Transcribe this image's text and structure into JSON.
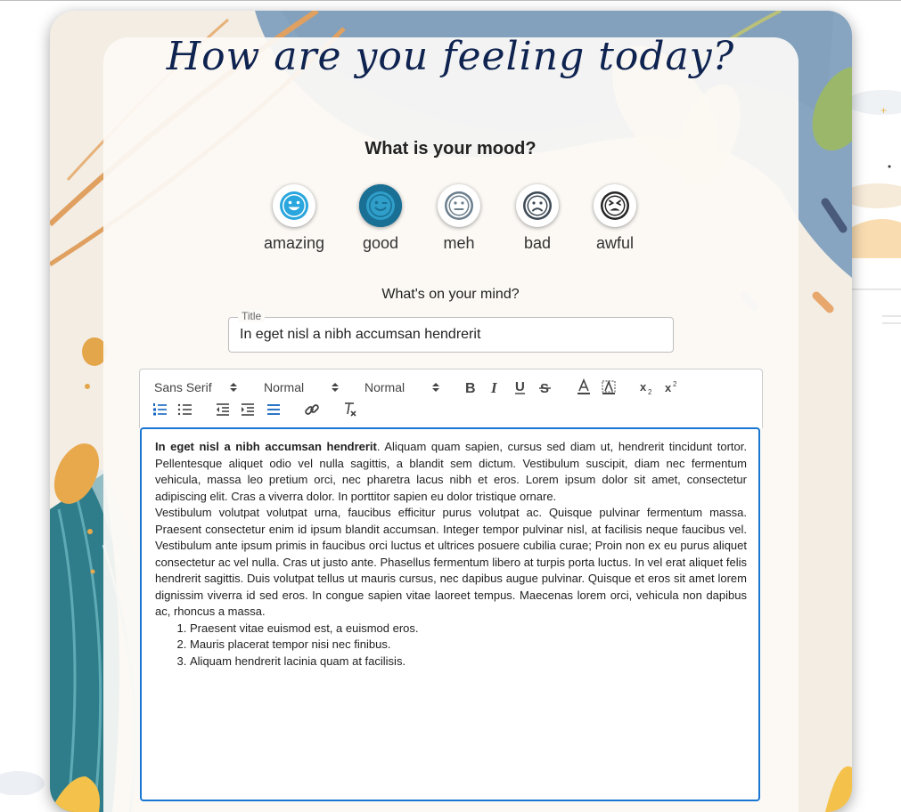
{
  "heading": "How are you feeling today?",
  "mood_question": "What is your mood?",
  "moods": [
    {
      "label": "amazing",
      "icon": "grinning-face-icon",
      "color": "#29a6dd"
    },
    {
      "label": "good",
      "icon": "winking-face-icon",
      "color": "#1a6f94",
      "selected": true
    },
    {
      "label": "meh",
      "icon": "neutral-face-icon",
      "color": "#6b7f8e"
    },
    {
      "label": "bad",
      "icon": "frowning-face-icon",
      "color": "#3d4a55"
    },
    {
      "label": "awful",
      "icon": "tired-face-icon",
      "color": "#262626"
    }
  ],
  "mind_prompt": "What's on your mind?",
  "title_field": {
    "label": "Title",
    "value": "In eget nisl a nibh accumsan hendrerit"
  },
  "toolbar": {
    "font": "Sans Serif",
    "size": "Normal",
    "header": "Normal",
    "icons": [
      "bold-icon",
      "italic-icon",
      "underline-icon",
      "strikethrough-icon",
      "text-color-icon",
      "background-color-icon",
      "subscript-icon",
      "superscript-icon",
      "ordered-list-icon",
      "bullet-list-icon",
      "outdent-icon",
      "indent-icon",
      "justify-icon",
      "link-icon",
      "clear-format-icon"
    ],
    "active_color": "#1565c0"
  },
  "editor": {
    "para1_bold": "In eget nisl a nibh accumsan hendrerit",
    "para1_rest": ". Aliquam quam sapien, cursus sed diam ut, hendrerit tincidunt tortor. Pellentesque aliquet odio vel nulla sagittis, a blandit sem dictum. Vestibulum suscipit, diam nec fermentum vehicula, massa leo pretium orci, nec pharetra lacus nibh et eros. Lorem ipsum dolor sit amet, consectetur adipiscing elit. Cras a viverra dolor. In porttitor sapien eu dolor tristique ornare.",
    "para2": "Vestibulum volutpat volutpat urna, faucibus efficitur purus volutpat ac. Quisque pulvinar fermentum massa. Praesent consectetur enim id ipsum blandit accumsan. Integer tempor pulvinar nisl, at facilisis neque faucibus vel. Vestibulum ante ipsum primis in faucibus orci luctus et ultrices posuere cubilia curae; Proin non ex eu purus aliquet consectetur ac vel nulla. Cras ut justo ante. Phasellus fermentum libero at turpis porta luctus. In vel erat aliquet felis hendrerit sagittis. Duis volutpat tellus ut mauris cursus, nec dapibus augue pulvinar. Quisque et eros sit amet lorem dignissim viverra id sed eros. In congue sapien vitae laoreet tempus. Maecenas lorem orci, vehicula non dapibus ac, rhoncus a massa.",
    "list": [
      "Praesent vitae euismod est, a euismod eros.",
      "Mauris placerat tempor nisi nec finibus.",
      "Aliquam hendrerit lacinia quam at facilisis."
    ],
    "border_color": "#1976d2"
  }
}
